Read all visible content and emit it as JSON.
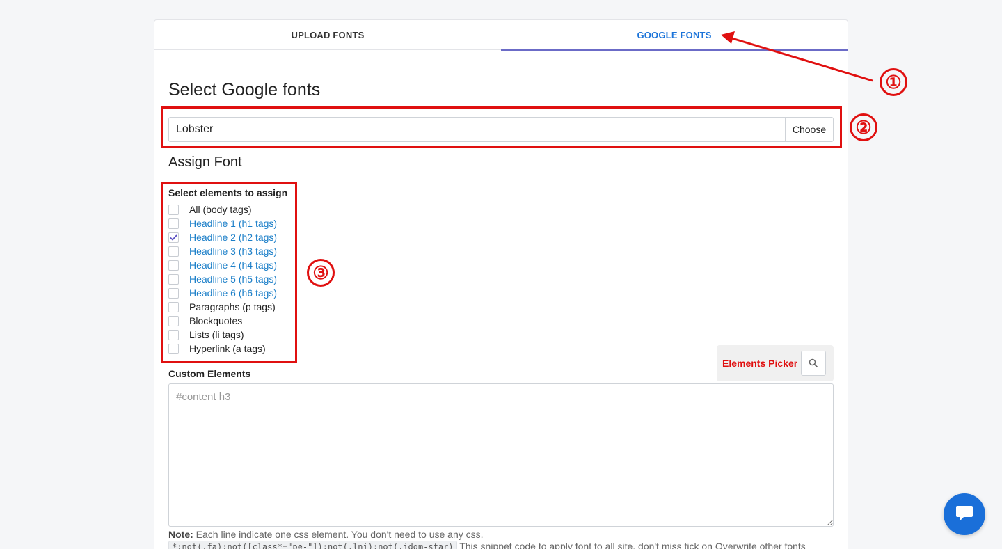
{
  "tabs": [
    {
      "label": "UPLOAD FONTS",
      "active": false
    },
    {
      "label": "GOOGLE FONTS",
      "active": true
    }
  ],
  "section_title": "Select Google fonts",
  "font_input": {
    "value": "Lobster"
  },
  "choose_label": "Choose",
  "assign_title": "Assign Font",
  "select_label": "Select elements to assign",
  "elements": [
    {
      "label": "All (body tags)",
      "checked": false,
      "link": false
    },
    {
      "label": "Headline 1 (h1 tags)",
      "checked": false,
      "link": true
    },
    {
      "label": "Headline 2 (h2 tags)",
      "checked": true,
      "link": true
    },
    {
      "label": "Headline 3 (h3 tags)",
      "checked": false,
      "link": true
    },
    {
      "label": "Headline 4 (h4 tags)",
      "checked": false,
      "link": true
    },
    {
      "label": "Headline 5 (h5 tags)",
      "checked": false,
      "link": true
    },
    {
      "label": "Headline 6 (h6 tags)",
      "checked": false,
      "link": true
    },
    {
      "label": "Paragraphs (p tags)",
      "checked": false,
      "link": false
    },
    {
      "label": "Blockquotes",
      "checked": false,
      "link": false
    },
    {
      "label": "Lists (li tags)",
      "checked": false,
      "link": false
    },
    {
      "label": "Hyperlink (a tags)",
      "checked": false,
      "link": false
    }
  ],
  "picker": {
    "label": "Elements Picker",
    "icon": "search-icon"
  },
  "custom_label": "Custom Elements",
  "custom_placeholder": "#content h3",
  "note": {
    "label": "Note:",
    "text": " Each line indicate one css element. You don't need to use any css.",
    "snippet": "*:not(.fa):not([class*=\"pe-\"]):not(.lni):not(.idgm-star)",
    "snippet_text": " This snippet code to apply font to all site, don't miss tick on Overwrite other fonts"
  },
  "annotations": [
    "①",
    "②",
    "③"
  ],
  "colors": {
    "accent": "#1a73d9",
    "annotation": "#e01010",
    "tab_underline": "#6b6bc7",
    "link": "#1a7ec8"
  }
}
